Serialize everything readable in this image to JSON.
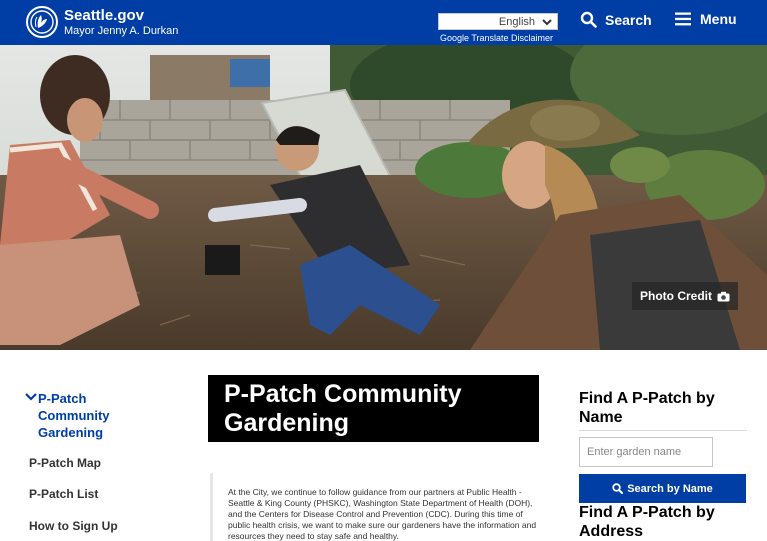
{
  "header": {
    "brand_name": "Seattle.gov",
    "brand_subtitle": "Mayor Jenny A. Durkan",
    "language_selected": "English",
    "translate_disclaimer": "Google Translate Disclaimer",
    "search_label": "Search",
    "menu_label": "Menu",
    "search_icon": "search-icon",
    "menu_icon": "hamburger-menu-icon"
  },
  "hero": {
    "photo_credit_label": "Photo Credit",
    "photo_credit_icon": "camera-icon"
  },
  "sidenav": {
    "current_label": "P-Patch Community Gardening",
    "items": [
      {
        "label": "P-Patch Map"
      },
      {
        "label": "P-Patch List"
      },
      {
        "label": "How to Sign Up"
      }
    ]
  },
  "main": {
    "title": "P-Patch Community Gardening",
    "body_text": "At the City, we continue to follow guidance from our partners at Public Health - Seattle & King County (PHSKC), Washington State Department of Health (DOH), and the Centers for Disease Control and Prevention (CDC).  During this time of public health crisis, we want to make sure our gardeners have the information and resources they need to stay safe and healthy."
  },
  "rail": {
    "find_by_name_heading": "Find A P-Patch by Name",
    "name_input_placeholder": "Enter garden name",
    "name_button_label": "Search by Name",
    "find_by_address_heading": "Find A P-Patch by Address"
  },
  "colors": {
    "brand_blue": "#003da5",
    "title_background": "#000000"
  }
}
